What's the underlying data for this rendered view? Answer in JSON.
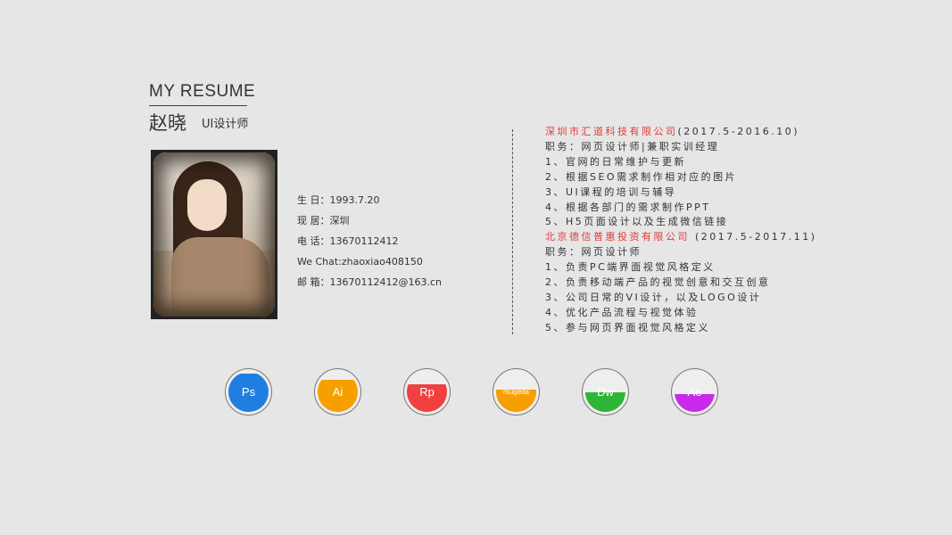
{
  "header": {
    "title": "MY RESUME",
    "name": "赵晓",
    "role": "UI设计师"
  },
  "info": {
    "birth": "生 日：1993.7.20",
    "residence": "现 居：深圳",
    "phone": "电 话：13670112412",
    "wechat": "We Chat:zhaoxiao408150",
    "email": "邮 箱：13670112412@163.cn"
  },
  "experience": [
    {
      "company": "深圳市汇道科技有限公司",
      "dates": "(2017.5-2016.10)",
      "title": "职务：网页设计师|兼职实训经理",
      "duties": [
        "1、官网的日常维护与更新",
        "2、根据SEO需求制作相对应的图片",
        "3、UI课程的培训与辅导",
        "4、根据各部门的需求制作PPT",
        "5、H5页面设计以及生成微信链接"
      ]
    },
    {
      "company": "北京德信普惠投资有限公司",
      "dates": " (2017.5-2017.11)",
      "title": "职务：网页设计师",
      "duties": [
        "1、负责PC端界面视觉风格定义",
        "2、负责移动端产品的视觉创意和交互创意",
        "3、公司日常的VI设计，以及LOGO设计",
        "4、优化产品流程与视觉体验",
        "5、参与网页界面视觉风格定义"
      ]
    }
  ],
  "skills": [
    {
      "label": "Ps",
      "color": "#1f7fe0",
      "level": 0.95
    },
    {
      "label": "Ai",
      "color": "#f5a000",
      "level": 0.8
    },
    {
      "label": "Rp",
      "color": "#f04040",
      "level": 0.7
    },
    {
      "label": "mugeda",
      "color": "#f5a000",
      "level": 0.55
    },
    {
      "label": "Dw",
      "color": "#2db536",
      "level": 0.5
    },
    {
      "label": "Ae",
      "color": "#c72ae8",
      "level": 0.45
    }
  ]
}
